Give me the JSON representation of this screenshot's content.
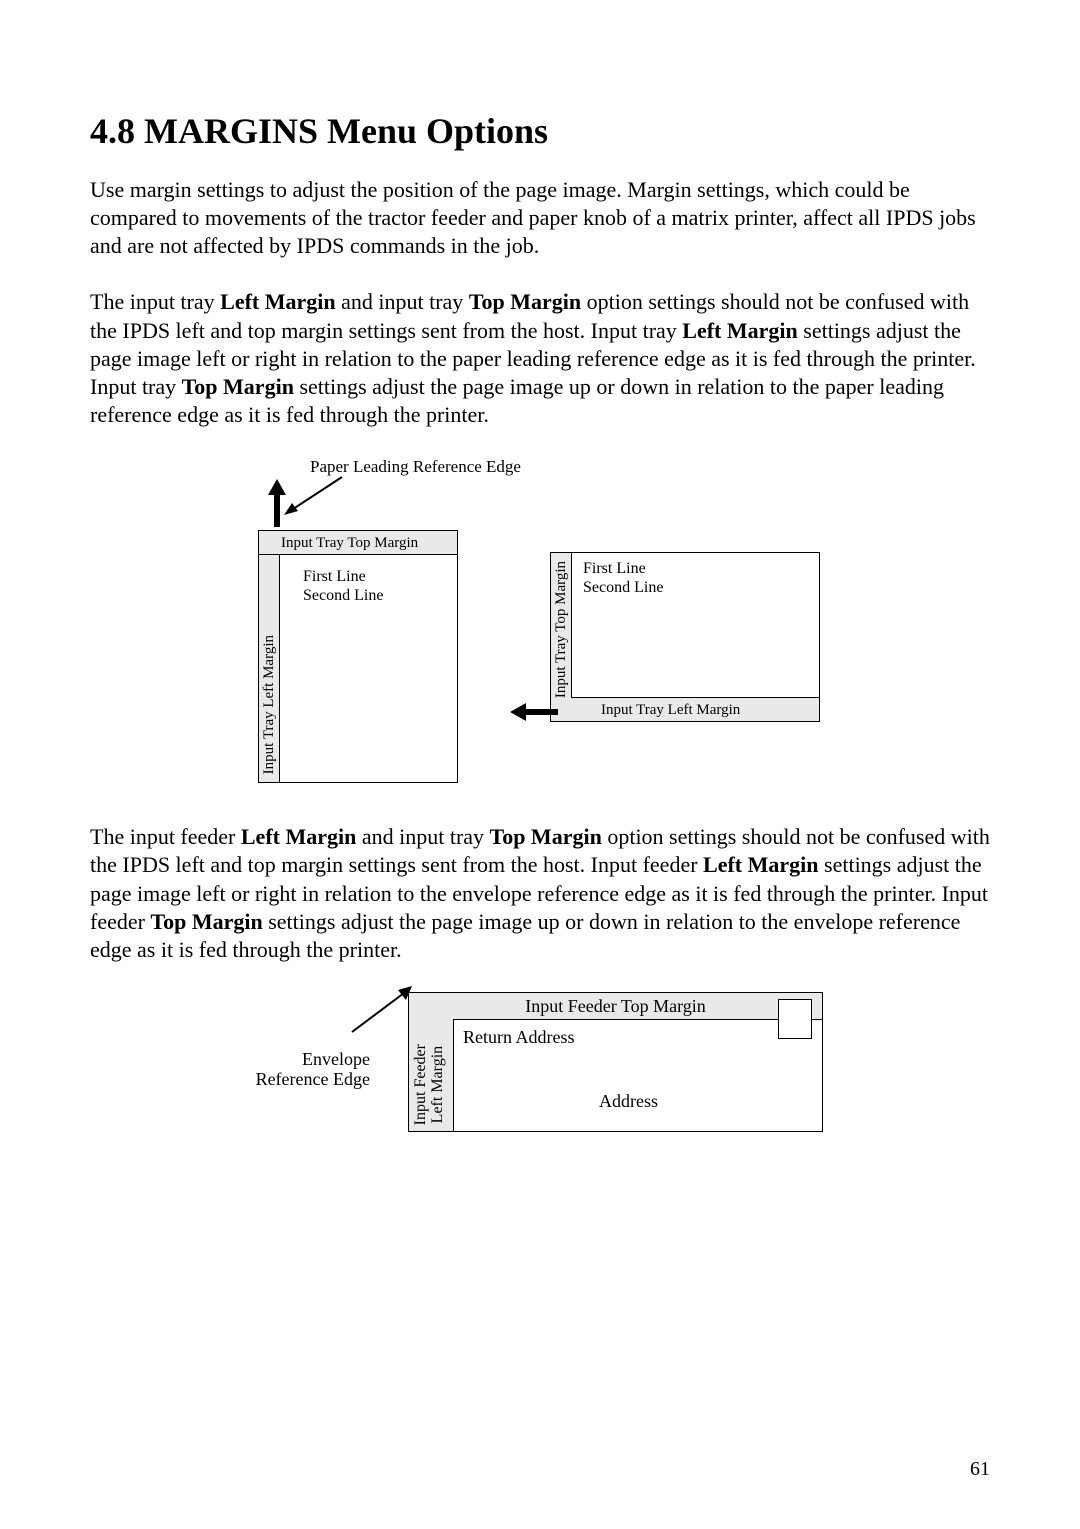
{
  "heading": "4.8 MARGINS Menu Options",
  "paragraph1": "Use margin settings to adjust the position of the page image. Margin settings, which could be compared to movements of the tractor feeder and paper knob of a matrix printer, affect all IPDS jobs and are not affected by IPDS commands in the job.",
  "paragraph2": {
    "s1": "The input tray ",
    "b1": "Left Margin",
    "s2": " and input tray ",
    "b2": "Top Margin",
    "s3": " option settings should not be confused with the IPDS left and top margin settings sent from the host. Input tray ",
    "b3": "Left Margin",
    "s4": " settings adjust the page image left or right in relation to the paper leading reference edge as it is fed through the printer. Input tray ",
    "b4": "Top Margin",
    "s5": " settings adjust the page image up or down in relation to the paper leading reference edge as it is fed through the printer."
  },
  "diagram1": {
    "caption": "Paper Leading Reference Edge",
    "portrait": {
      "top_margin": "Input Tray Top Margin",
      "left_margin": "Input Tray Left Margin",
      "line1": "First Line",
      "line2": "Second Line"
    },
    "landscape": {
      "top_margin": "Input Tray Top Margin",
      "left_margin": "Input Tray Left Margin",
      "line1": "First Line",
      "line2": "Second Line"
    }
  },
  "paragraph3": {
    "s1": "The input feeder ",
    "b1": "Left Margin",
    "s2": " and input tray ",
    "b2": "Top Margin",
    "s3": " option settings should not be confused with the IPDS left and top margin settings sent from the host. Input feeder ",
    "b3": "Left Margin",
    "s4": " settings adjust the page image left or right in relation to the envelope reference edge as it is fed through the printer. Input feeder ",
    "b4": "Top Margin",
    "s5": " settings adjust the page image up or down in relation to the envelope reference edge as it is fed through the printer."
  },
  "diagram2": {
    "edge_label_line1": "Envelope",
    "edge_label_line2": "Reference Edge",
    "top_margin": "Input Feeder Top Margin",
    "left_margin_line1": "Input Feeder",
    "left_margin_line2": "Left Margin",
    "return_address": "Return Address",
    "address": "Address"
  },
  "page_number": "61"
}
